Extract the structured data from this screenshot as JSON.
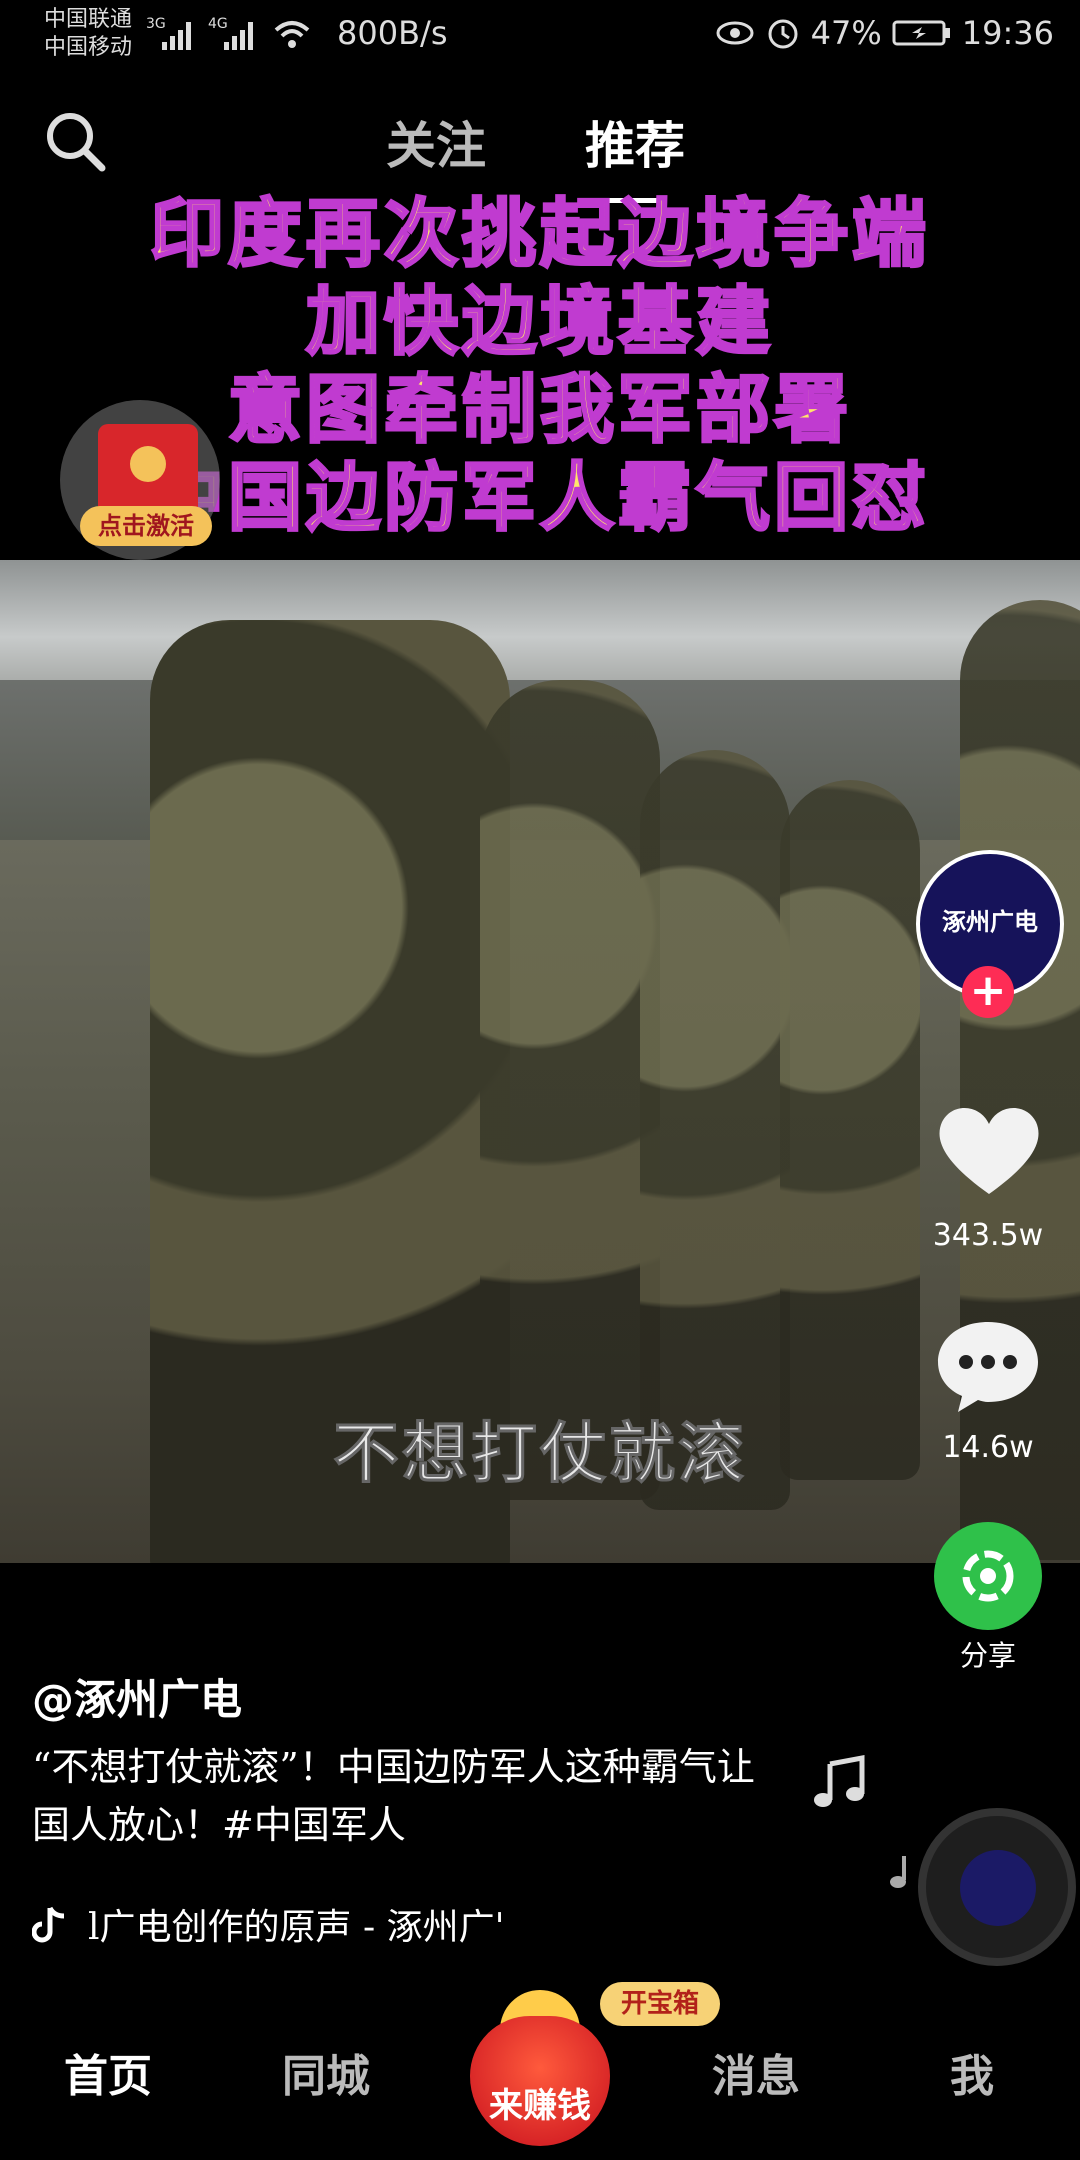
{
  "status_bar": {
    "carrier1": "中国联通",
    "carrier2": "中国移动",
    "net1": "3G",
    "net2": "4G",
    "speed": "800B/s",
    "battery": "47%",
    "time": "19:36"
  },
  "top_nav": {
    "follow": "关注",
    "recommend": "推荐"
  },
  "headline": [
    "印度再次挑起边境争端",
    "加快边境基建",
    "意图牵制我军部署",
    "中国边防军人霸气回怼"
  ],
  "red_packet": {
    "label": "点击激活"
  },
  "video": {
    "subtitle": "不想打仗就滚"
  },
  "right_rail": {
    "avatar_text": "涿州广电",
    "likes": "343.5w",
    "comments": "14.6w",
    "share": "分享"
  },
  "post": {
    "author": "@涿州广电",
    "description": "“不想打仗就滚”！中国边防军人这种霸气让国人放心！#中国军人",
    "music": "l广电创作的原声 - 涿州广'"
  },
  "bottom_nav": {
    "home": "首页",
    "nearby": "同城",
    "earn": "来赚钱",
    "treasure": "开宝箱",
    "messages": "消息",
    "me": "我"
  }
}
